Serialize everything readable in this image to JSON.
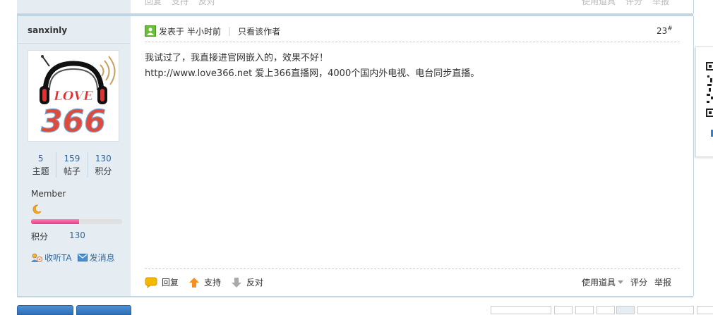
{
  "prev_post": {
    "reply": "回复",
    "support": "支持",
    "oppose": "反对",
    "tools": "使用道具",
    "rate": "评分",
    "report": "举报"
  },
  "user": {
    "name": "sanxinly",
    "avatar_text": "366",
    "stats": [
      {
        "num": "5",
        "label": "主题"
      },
      {
        "num": "159",
        "label": "帖子"
      },
      {
        "num": "130",
        "label": "积分"
      }
    ],
    "rank": "Member",
    "level_progress": 0.53,
    "points_label": "积分",
    "points_value": "130",
    "follow": "收听TA",
    "message": "发消息"
  },
  "post": {
    "posted_label": "发表于",
    "time": "半小时前",
    "only_author": "只看该作者",
    "floor": "23",
    "floor_mark": "#",
    "lines": [
      "我试过了，我直接进官网嵌入的，效果不好！",
      "http://www.love366.net 爱上366直播网，4000个国内外电视、电台同步直播。"
    ]
  },
  "actions": {
    "reply": "回复",
    "support": "支持",
    "oppose": "反对",
    "tools": "使用道具",
    "rate": "评分",
    "report": "举报"
  },
  "colors": {
    "sidebar_bg": "#e5edf2",
    "border": "#c2d5e3",
    "link": "#336699",
    "progress": "#e8388a"
  }
}
